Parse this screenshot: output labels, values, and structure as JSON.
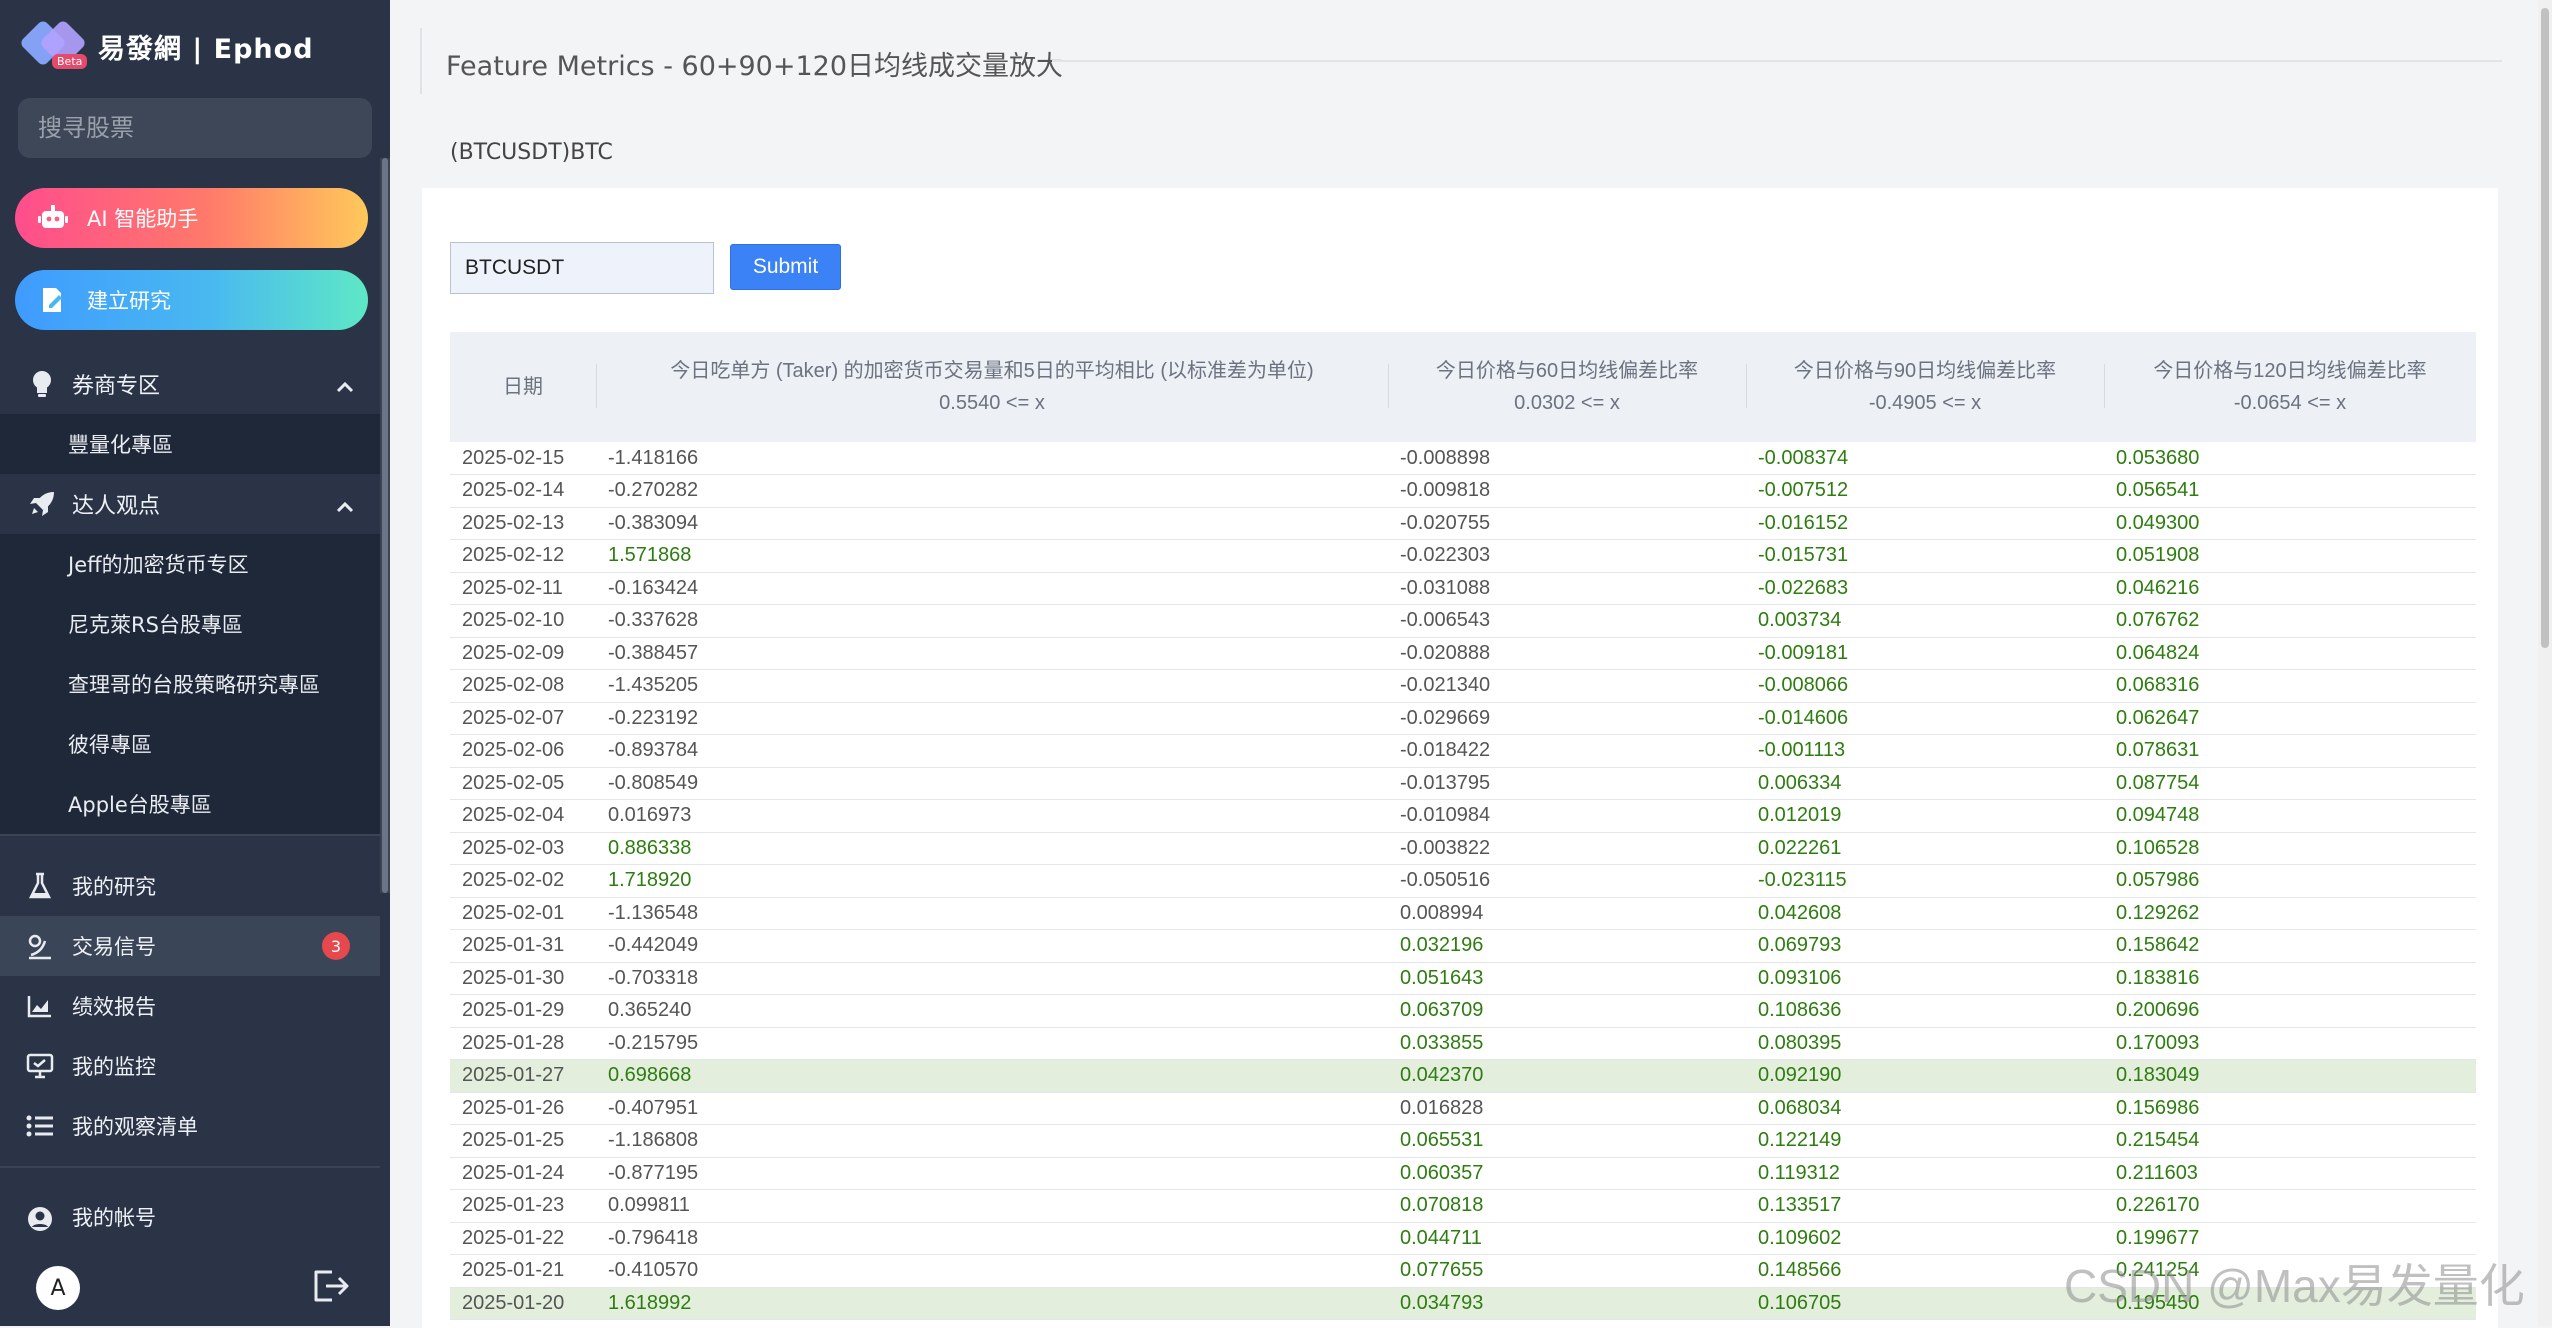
{
  "sidebar": {
    "logo_text": "易發網 | Ephod",
    "logo_badge": "Beta",
    "search_placeholder": "搜寻股票",
    "ai_button": "AI 智能助手",
    "research_button": "建立研究",
    "broker_section": "券商专区",
    "broker_items": [
      "豐量化專區"
    ],
    "experts_section": "达人观点",
    "expert_items": [
      "Jeff的加密货币专区",
      "尼克萊RS台股專區",
      "查理哥的台股策略研究專區",
      "彼得專區",
      "Apple台股專區"
    ],
    "nav": [
      {
        "label": "我的研究",
        "icon": "flask-icon"
      },
      {
        "label": "交易信号",
        "icon": "signal-icon",
        "badge": "3"
      },
      {
        "label": "绩效报告",
        "icon": "chart-icon"
      },
      {
        "label": "我的监控",
        "icon": "monitor-icon"
      },
      {
        "label": "我的观察清单",
        "icon": "list-icon"
      }
    ],
    "account_label": "我的帐号",
    "avatar_letter": "A"
  },
  "main": {
    "title": "Feature Metrics - 60+90+120日均线成交量放大",
    "symbol_label": "(BTCUSDT)BTC",
    "ticker_value": "BTCUSDT",
    "submit_label": "Submit"
  },
  "table": {
    "headers": [
      {
        "title": "日期",
        "sub": ""
      },
      {
        "title": "今日吃单方 (Taker) 的加密货币交易量和5日的平均相比 (以标准差为单位)",
        "sub": "0.5540 <= x"
      },
      {
        "title": "今日价格与60日均线偏差比率",
        "sub": "0.0302 <= x"
      },
      {
        "title": "今日价格与90日均线偏差比率",
        "sub": "-0.4905 <= x"
      },
      {
        "title": "今日价格与120日均线偏差比率",
        "sub": "-0.0654 <= x"
      }
    ],
    "rows": [
      [
        "2025-02-15",
        "-1.418166",
        "-0.008898",
        "-0.008374",
        "0.053680"
      ],
      [
        "2025-02-14",
        "-0.270282",
        "-0.009818",
        "-0.007512",
        "0.056541"
      ],
      [
        "2025-02-13",
        "-0.383094",
        "-0.020755",
        "-0.016152",
        "0.049300"
      ],
      [
        "2025-02-12",
        "1.571868",
        "-0.022303",
        "-0.015731",
        "0.051908"
      ],
      [
        "2025-02-11",
        "-0.163424",
        "-0.031088",
        "-0.022683",
        "0.046216"
      ],
      [
        "2025-02-10",
        "-0.337628",
        "-0.006543",
        "0.003734",
        "0.076762"
      ],
      [
        "2025-02-09",
        "-0.388457",
        "-0.020888",
        "-0.009181",
        "0.064824"
      ],
      [
        "2025-02-08",
        "-1.435205",
        "-0.021340",
        "-0.008066",
        "0.068316"
      ],
      [
        "2025-02-07",
        "-0.223192",
        "-0.029669",
        "-0.014606",
        "0.062647"
      ],
      [
        "2025-02-06",
        "-0.893784",
        "-0.018422",
        "-0.001113",
        "0.078631"
      ],
      [
        "2025-02-05",
        "-0.808549",
        "-0.013795",
        "0.006334",
        "0.087754"
      ],
      [
        "2025-02-04",
        "0.016973",
        "-0.010984",
        "0.012019",
        "0.094748"
      ],
      [
        "2025-02-03",
        "0.886338",
        "-0.003822",
        "0.022261",
        "0.106528"
      ],
      [
        "2025-02-02",
        "1.718920",
        "-0.050516",
        "-0.023115",
        "0.057986"
      ],
      [
        "2025-02-01",
        "-1.136548",
        "0.008994",
        "0.042608",
        "0.129262"
      ],
      [
        "2025-01-31",
        "-0.442049",
        "0.032196",
        "0.069793",
        "0.158642"
      ],
      [
        "2025-01-30",
        "-0.703318",
        "0.051643",
        "0.093106",
        "0.183816"
      ],
      [
        "2025-01-29",
        "0.365240",
        "0.063709",
        "0.108636",
        "0.200696"
      ],
      [
        "2025-01-28",
        "-0.215795",
        "0.033855",
        "0.080395",
        "0.170093"
      ],
      [
        "2025-01-27",
        "0.698668",
        "0.042370",
        "0.092190",
        "0.183049"
      ],
      [
        "2025-01-26",
        "-0.407951",
        "0.016828",
        "0.068034",
        "0.156986"
      ],
      [
        "2025-01-25",
        "-1.186808",
        "0.065531",
        "0.122149",
        "0.215454"
      ],
      [
        "2025-01-24",
        "-0.877195",
        "0.060357",
        "0.119312",
        "0.211603"
      ],
      [
        "2025-01-23",
        "0.099811",
        "0.070818",
        "0.133517",
        "0.226170"
      ],
      [
        "2025-01-22",
        "-0.796418",
        "0.044711",
        "0.109602",
        "0.199677"
      ],
      [
        "2025-01-21",
        "-0.410570",
        "0.077655",
        "0.148566",
        "0.241254"
      ],
      [
        "2025-01-20",
        "1.618992",
        "0.034793",
        "0.106705",
        "0.195450"
      ]
    ],
    "thresholds": [
      0.554,
      0.0302,
      -0.4905,
      -0.0654
    ],
    "colors": {
      "pass": "#2e7d10",
      "fail": "#555555",
      "row_highlight": "#e3eedd"
    }
  },
  "watermark": "CSDN @Max易发量化"
}
